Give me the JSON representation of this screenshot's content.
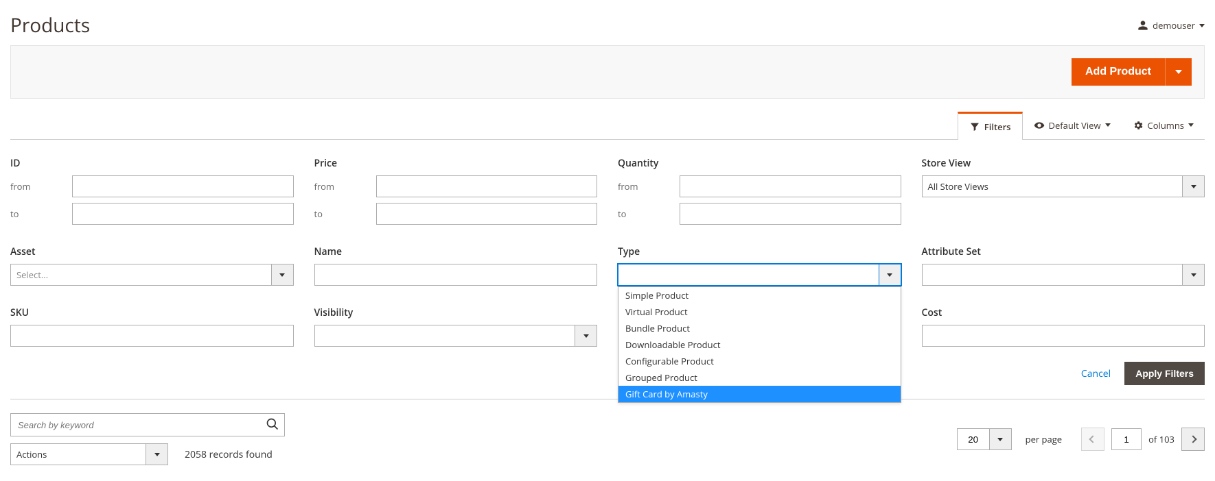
{
  "header": {
    "title": "Products",
    "user": "demouser"
  },
  "actions": {
    "add_product": "Add Product"
  },
  "toolbar": {
    "filters": "Filters",
    "default_view": "Default View",
    "columns": "Columns"
  },
  "filters": {
    "id": {
      "label": "ID"
    },
    "price": {
      "label": "Price"
    },
    "quantity": {
      "label": "Quantity"
    },
    "store_view": {
      "label": "Store View",
      "value": "All Store Views"
    },
    "asset": {
      "label": "Asset",
      "placeholder": "Select..."
    },
    "name": {
      "label": "Name"
    },
    "type": {
      "label": "Type",
      "options": [
        "Simple Product",
        "Virtual Product",
        "Bundle Product",
        "Downloadable Product",
        "Configurable Product",
        "Grouped Product",
        "Gift Card by Amasty"
      ]
    },
    "attribute_set": {
      "label": "Attribute Set"
    },
    "sku": {
      "label": "SKU"
    },
    "visibility": {
      "label": "Visibility"
    },
    "cost": {
      "label": "Cost"
    },
    "range": {
      "from": "from",
      "to": "to"
    },
    "buttons": {
      "cancel": "Cancel",
      "apply": "Apply Filters"
    }
  },
  "search": {
    "placeholder": "Search by keyword"
  },
  "bulk_actions": {
    "label": "Actions"
  },
  "records": {
    "count": "2058",
    "text": "records found"
  },
  "pagination": {
    "page_size": "20",
    "per_page": "per page",
    "current": "1",
    "of": "of",
    "total": "103"
  }
}
